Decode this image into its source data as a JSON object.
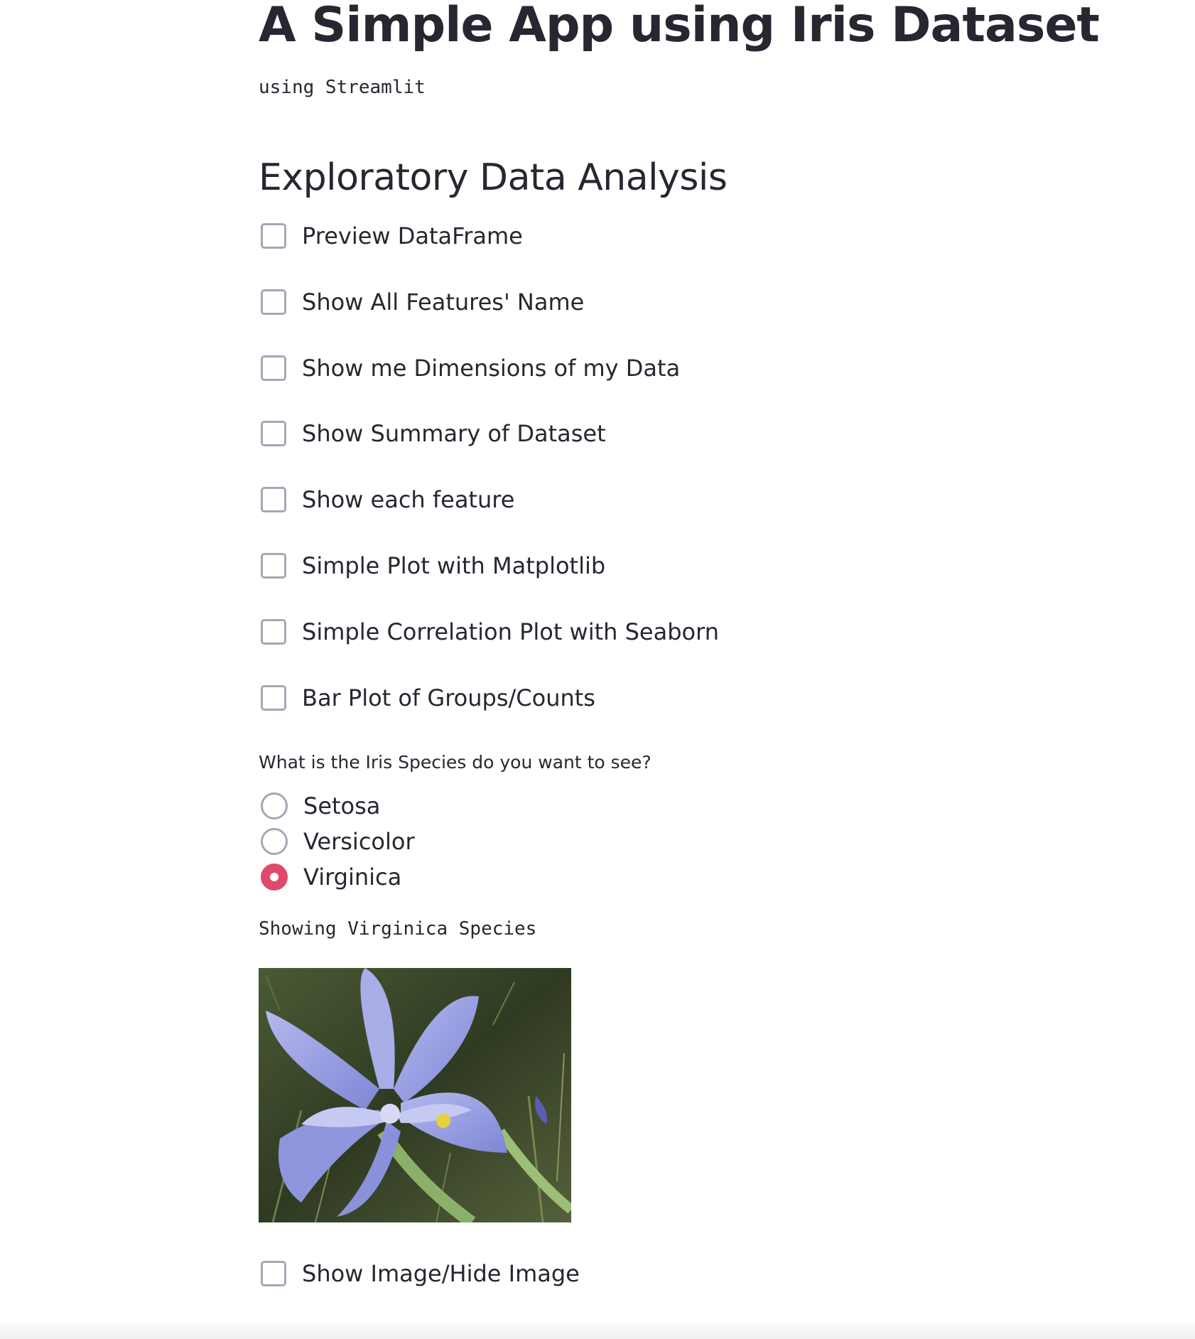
{
  "header": {
    "title": "A Simple App using Iris Dataset",
    "subtitle": "using Streamlit"
  },
  "eda": {
    "heading": "Exploratory Data Analysis",
    "checkboxes": [
      {
        "label": "Preview DataFrame",
        "checked": false
      },
      {
        "label": "Show All Features' Name",
        "checked": false
      },
      {
        "label": "Show me Dimensions of my Data",
        "checked": false
      },
      {
        "label": "Show Summary of Dataset",
        "checked": false
      },
      {
        "label": "Show each feature",
        "checked": false
      },
      {
        "label": "Simple Plot with Matplotlib",
        "checked": false
      },
      {
        "label": "Simple Correlation Plot with Seaborn",
        "checked": false
      },
      {
        "label": "Bar Plot of Groups/Counts",
        "checked": false
      }
    ]
  },
  "species": {
    "question": "What is the Iris Species do you want to see?",
    "options": [
      "Setosa",
      "Versicolor",
      "Virginica"
    ],
    "selected": "Virginica",
    "showing_text": "Showing Virginica Species"
  },
  "image_toggle": {
    "label": "Show Image/Hide Image",
    "checked": false
  },
  "colors": {
    "accent": "#e04a6a",
    "text": "#262730",
    "checkbox_border": "#a3a8b4"
  }
}
